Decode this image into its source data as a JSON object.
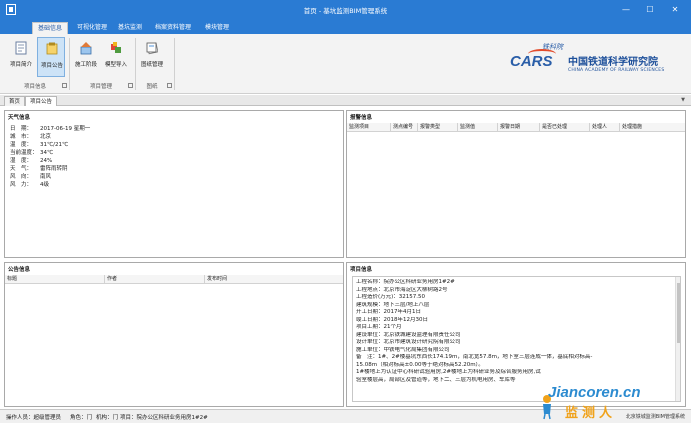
{
  "window": {
    "title": "首页 - 基坑监测BIM管理系统",
    "controls": [
      "—",
      "☐",
      "✕"
    ]
  },
  "ribbon_tabs": [
    "基础信息",
    "可视化管理",
    "基坑监测",
    "档案资料管理",
    "模块管理"
  ],
  "ribbon": {
    "groups": [
      {
        "label": "项目信息",
        "buttons": [
          "项目简介",
          "项目公告"
        ]
      },
      {
        "label": "项目管理",
        "buttons": [
          "施工阶段",
          "模型导入"
        ]
      },
      {
        "label": "图纸",
        "buttons": [
          "图纸管理"
        ]
      }
    ]
  },
  "logo": {
    "stamp": "铁科院",
    "cars": "CARS",
    "cn": "中国铁道科学研究院",
    "en": "CHINA ACADEMY OF RAILWAY SCIENCES"
  },
  "doc_tabs": [
    "首页",
    "项目公告"
  ],
  "weather": {
    "title": "天气信息",
    "rows": [
      {
        "k": "日　期：",
        "v": "2017-06-19  星期一"
      },
      {
        "k": "城　市：",
        "v": "北京"
      },
      {
        "k": "温　度：",
        "v": "31℃/21℃"
      },
      {
        "k": "当前温度：",
        "v": "34℃"
      },
      {
        "k": "湿　度：",
        "v": "24%"
      },
      {
        "k": "天　气：",
        "v": "雷阵雨转阴"
      },
      {
        "k": "风　向：",
        "v": "南风"
      },
      {
        "k": "风　力：",
        "v": "4级"
      }
    ]
  },
  "alarm": {
    "title": "报警信息",
    "columns": [
      "监测项目",
      "测点编号",
      "报警类型",
      "监测值",
      "报警日期",
      "是否已处理",
      "处理人",
      "处理措施"
    ]
  },
  "notice": {
    "title": "公告信息",
    "columns": [
      "标题",
      "作者",
      "发布时间"
    ]
  },
  "project": {
    "title": "项目信息",
    "lines": [
      "工程名称：院办公区科研业务用房1#2#",
      "工程地点：北京市海淀区大柳树路2号",
      "工程造价(万元)：32157.50",
      "建筑规模：地下三层/地上八层",
      "开工日期：2017年4月1日",
      "竣工日期：2018年12月30日",
      "项目工期：21个月",
      "建设单位：北京铁城建设监理有限责任公司",
      "设计单位：北京市建筑设计研究院有限公司",
      "施工单位：中铁电气化局集团有限公司",
      "备　注：1#、2#楼基坑东西长174.19m，南北宽57.8m，地下室三层连成一体，基底相对标高-",
      "15.08m（相对标高±0.00等于绝对标高52.20m）。",
      "1#楼地上为认证中心科研试验用房,2#楼地上为科研业务及综合服务用房,试",
      "验室楼层高，局部区及管道等，地下二、三层为机电用房、车库等"
    ]
  },
  "status": {
    "user": "操作人员：超级管理员",
    "role": "角色：门",
    "org": "机构：门",
    "project": "项目：院办公区科研业务用房1#2#",
    "right": "北京铁城监测BIM管理系统"
  },
  "watermark": {
    "site": "Jiancoren.cn",
    "cn": "监测人"
  }
}
